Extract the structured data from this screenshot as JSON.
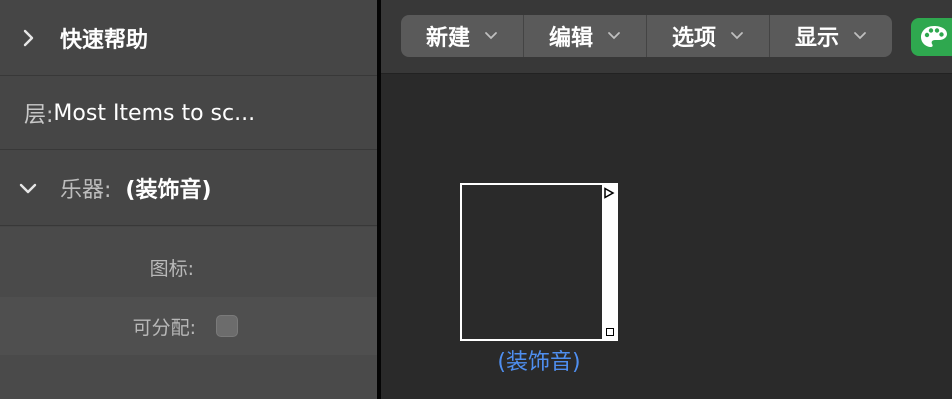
{
  "inspector": {
    "quick_help": {
      "title": "快速帮助",
      "chevron": "chevron-right-icon"
    },
    "layer": {
      "label": "层:",
      "value": "Most Items to sc..."
    },
    "instrument": {
      "label": "乐器:",
      "value": "(装饰音)",
      "chevron": "chevron-down-icon"
    },
    "properties": {
      "icon_label": "图标:",
      "assignable_label": "可分配:",
      "assignable_checked": false
    }
  },
  "toolbar": {
    "menus": [
      {
        "label": "新建"
      },
      {
        "label": "编辑"
      },
      {
        "label": "选项"
      },
      {
        "label": "显示"
      }
    ],
    "palette_icon": "palette-icon",
    "palette_color": "#2fa84f"
  },
  "canvas": {
    "node": {
      "label": "(装饰音)",
      "label_color": "#4f8ff0"
    }
  }
}
